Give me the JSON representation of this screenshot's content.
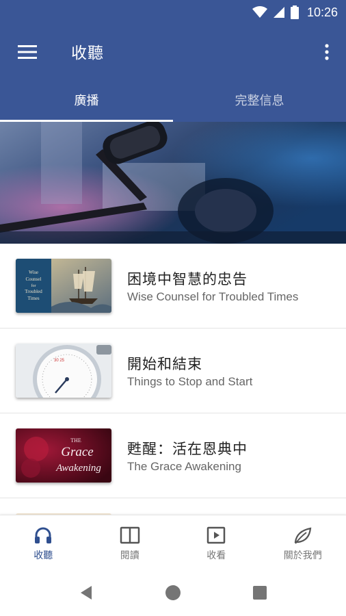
{
  "status_bar": {
    "time": "10:26",
    "icons": [
      "wifi-icon",
      "cell-signal-icon",
      "battery-icon"
    ]
  },
  "app_bar": {
    "title": "收聽",
    "menu_icon": "hamburger-menu-icon",
    "overflow_icon": "more-vert-icon"
  },
  "tabs": [
    {
      "label": "廣播",
      "active": true
    },
    {
      "label": "完整信息",
      "active": false
    }
  ],
  "hero": {
    "image": "podcast-microphone-studio"
  },
  "programs": [
    {
      "title": "困境中智慧的忠告",
      "subtitle": "Wise Counsel for Troubled Times",
      "thumb_text": [
        "Wise",
        "Counsel",
        "for",
        "Troubled",
        "Times"
      ]
    },
    {
      "title": "開始和結束",
      "subtitle": "Things to Stop and Start",
      "thumb_text": []
    },
    {
      "title": "甦醒：活在恩典中",
      "subtitle": "The Grace Awakening",
      "thumb_text": [
        "THE",
        "Grace",
        "Awakening"
      ]
    }
  ],
  "bottom_nav": [
    {
      "label": "收聽",
      "icon": "headphones-icon",
      "active": true
    },
    {
      "label": "閱讀",
      "icon": "book-icon",
      "active": false
    },
    {
      "label": "收看",
      "icon": "play-video-icon",
      "active": false
    },
    {
      "label": "關於我們",
      "icon": "leaf-icon",
      "active": false
    }
  ],
  "colors": {
    "primary": "#3a5696",
    "active_nav": "#2f4f8f",
    "text_primary": "#222222",
    "text_secondary": "#666666"
  }
}
